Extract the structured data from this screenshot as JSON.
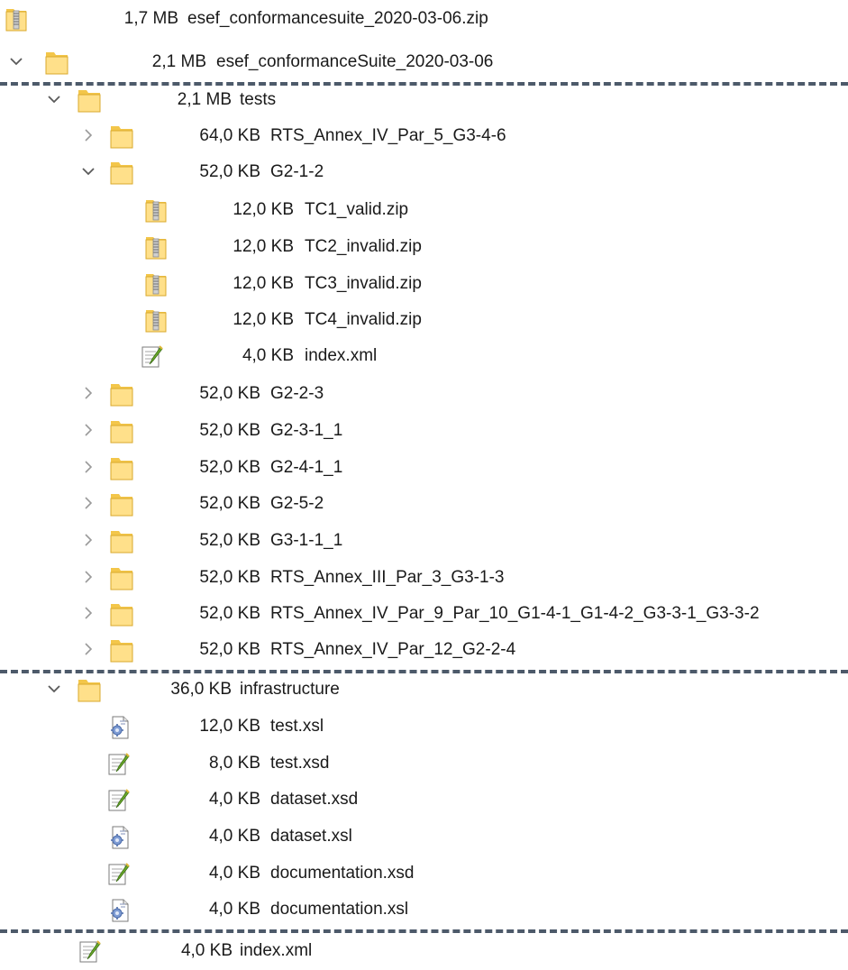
{
  "rows": [
    {
      "size": "1,7 MB",
      "name": "esef_conformancesuite_2020-03-06.zip",
      "icon": "zip-archive-icon"
    },
    {
      "size": "2,1 MB",
      "name": "esef_conformanceSuite_2020-03-06",
      "icon": "folder-icon",
      "expanded": true
    },
    {
      "size": "2,1 MB",
      "name": "tests",
      "icon": "folder-icon",
      "expanded": true
    },
    {
      "size": "64,0 KB",
      "name": "RTS_Annex_IV_Par_5_G3-4-6",
      "icon": "folder-icon",
      "expanded": false
    },
    {
      "size": "52,0 KB",
      "name": "G2-1-2",
      "icon": "folder-icon",
      "expanded": true
    },
    {
      "size": "12,0 KB",
      "name": "TC1_valid.zip",
      "icon": "zip-archive-icon"
    },
    {
      "size": "12,0 KB",
      "name": "TC2_invalid.zip",
      "icon": "zip-archive-icon"
    },
    {
      "size": "12,0 KB",
      "name": "TC3_invalid.zip",
      "icon": "zip-archive-icon"
    },
    {
      "size": "12,0 KB",
      "name": "TC4_invalid.zip",
      "icon": "zip-archive-icon"
    },
    {
      "size": "4,0 KB",
      "name": "index.xml",
      "icon": "xml-document-icon"
    },
    {
      "size": "52,0 KB",
      "name": "G2-2-3",
      "icon": "folder-icon",
      "expanded": false
    },
    {
      "size": "52,0 KB",
      "name": "G2-3-1_1",
      "icon": "folder-icon",
      "expanded": false
    },
    {
      "size": "52,0 KB",
      "name": "G2-4-1_1",
      "icon": "folder-icon",
      "expanded": false
    },
    {
      "size": "52,0 KB",
      "name": "G2-5-2",
      "icon": "folder-icon",
      "expanded": false
    },
    {
      "size": "52,0 KB",
      "name": "G3-1-1_1",
      "icon": "folder-icon",
      "expanded": false
    },
    {
      "size": "52,0 KB",
      "name": "RTS_Annex_III_Par_3_G3-1-3",
      "icon": "folder-icon",
      "expanded": false
    },
    {
      "size": "52,0 KB",
      "name": "RTS_Annex_IV_Par_9_Par_10_G1-4-1_G1-4-2_G3-3-1_G3-3-2",
      "icon": "folder-icon",
      "expanded": false
    },
    {
      "size": "52,0 KB",
      "name": "RTS_Annex_IV_Par_12_G2-2-4",
      "icon": "folder-icon",
      "expanded": false
    },
    {
      "size": "36,0 KB",
      "name": "infrastructure",
      "icon": "folder-icon",
      "expanded": true
    },
    {
      "size": "12,0 KB",
      "name": "test.xsl",
      "icon": "xsl-stylesheet-icon"
    },
    {
      "size": "8,0 KB",
      "name": "test.xsd",
      "icon": "xml-document-icon"
    },
    {
      "size": "4,0 KB",
      "name": "dataset.xsd",
      "icon": "xml-document-icon"
    },
    {
      "size": "4,0 KB",
      "name": "dataset.xsl",
      "icon": "xsl-stylesheet-icon"
    },
    {
      "size": "4,0 KB",
      "name": "documentation.xsd",
      "icon": "xml-document-icon"
    },
    {
      "size": "4,0 KB",
      "name": "documentation.xsl",
      "icon": "xsl-stylesheet-icon"
    },
    {
      "size": "4,0 KB",
      "name": "index.xml",
      "icon": "xml-document-icon"
    }
  ],
  "colors": {
    "folder": "#f3c64a",
    "folder_light": "#ffe08a",
    "chevron": "#5a5a5a",
    "divider": "#4d5a6a",
    "checkmark": "#6aaa2a"
  }
}
